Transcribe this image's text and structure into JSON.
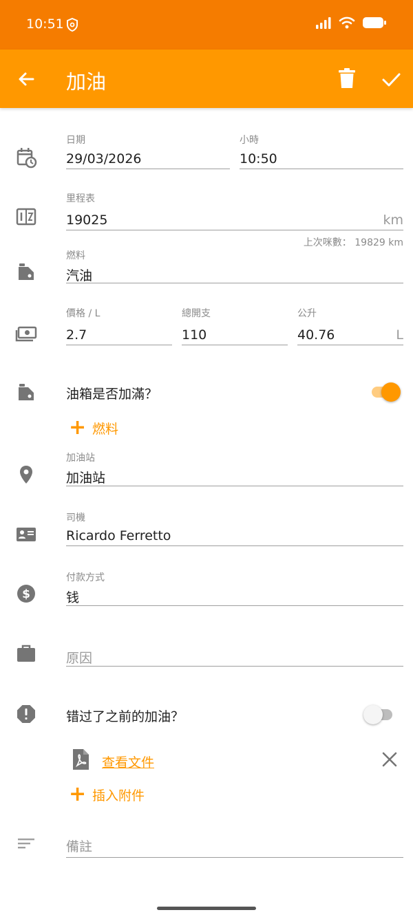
{
  "status": {
    "time": "10:51"
  },
  "app_bar": {
    "title": "加油"
  },
  "date": {
    "label": "日期",
    "value": "29/03/2026"
  },
  "time": {
    "label": "小時",
    "value": "10:50"
  },
  "odometer": {
    "label": "里程表",
    "value": "19025",
    "unit": "km",
    "hint": "上次咪數： 19829 km"
  },
  "fuel": {
    "label": "燃料",
    "value": "汽油"
  },
  "price": {
    "label": "價格 / L",
    "value": "2.7"
  },
  "total": {
    "label": "總開支",
    "value": "110"
  },
  "litres": {
    "label": "公升",
    "value": "40.76",
    "unit": "L"
  },
  "full_tank": {
    "label": "油箱是否加滿？",
    "on": true
  },
  "add_fuel": {
    "label": "燃料"
  },
  "station": {
    "label": "加油站",
    "value": "加油站"
  },
  "driver": {
    "label": "司機",
    "value": "Ricardo Ferretto"
  },
  "payment": {
    "label": "付款方式",
    "value": "钱"
  },
  "reason": {
    "placeholder": "原因"
  },
  "missed": {
    "label": "错过了之前的加油？",
    "on": false
  },
  "attachment": {
    "link": "查看文件"
  },
  "insert_attachment": {
    "label": "插入附件"
  },
  "notes": {
    "placeholder": "備註"
  },
  "colors": {
    "primary": "#ff9800",
    "status_bar": "#f57c00",
    "icon_grey": "#757575"
  }
}
